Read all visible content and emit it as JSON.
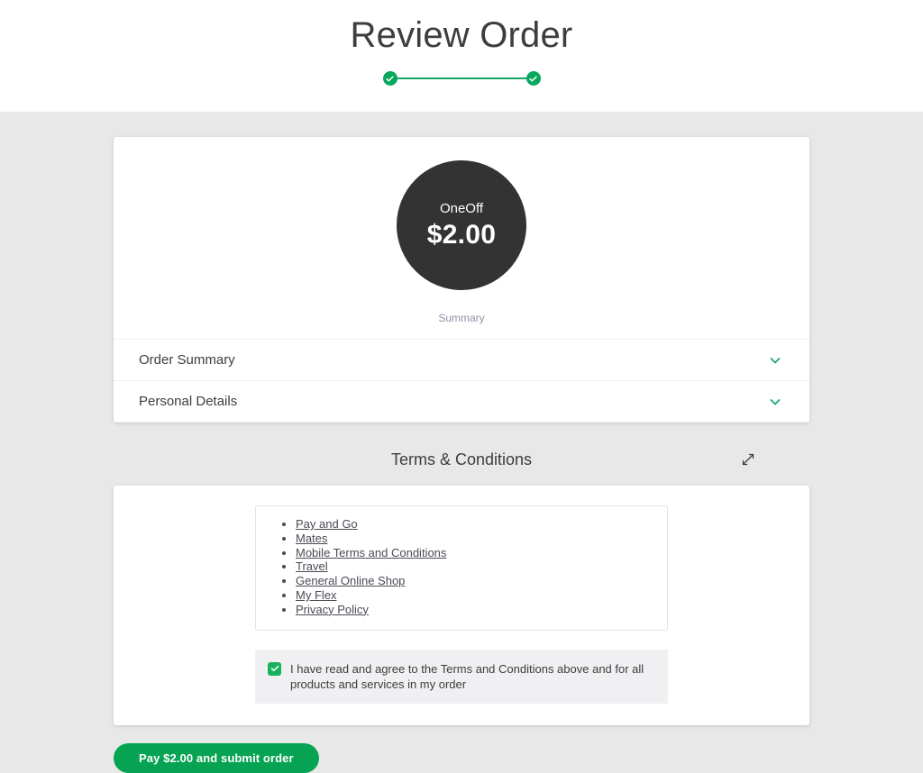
{
  "header": {
    "title": "Review Order",
    "stepper": {
      "steps": [
        {
          "name": "step-1",
          "state": "complete",
          "icon": "check-icon"
        },
        {
          "name": "step-2",
          "state": "complete",
          "icon": "check-icon"
        }
      ],
      "line_color": "#18a566",
      "dot_color": "#07a85e"
    }
  },
  "summary": {
    "bubble": {
      "label": "OneOff",
      "amount": "$2.00",
      "background": "#333333"
    },
    "caption": "Summary",
    "accordions": [
      {
        "label": "Order Summary",
        "icon": "chevron-down-icon",
        "expanded": false
      },
      {
        "label": "Personal Details",
        "icon": "chevron-down-icon",
        "expanded": false
      }
    ],
    "chevron_color": "#1aa877"
  },
  "terms": {
    "heading": "Terms & Conditions",
    "expand_icon": "expand-diagonal-icon",
    "links": [
      "Pay and Go",
      "Mates",
      "Mobile Terms and Conditions",
      "Travel",
      "General Online Shop",
      "My Flex",
      "Privacy Policy"
    ],
    "agreement": {
      "checked": true,
      "icon": "check-icon",
      "text": "I have read and agree to the Terms and Conditions above and for all products and services in my order",
      "checkbox_color": "#18b15f"
    }
  },
  "submit": {
    "label": "Pay $2.00 and submit order",
    "color": "#05a352"
  },
  "theme": {
    "page_background": "#e8e8e8",
    "card_background": "#ffffff",
    "text_color": "#3d3d3d",
    "muted_text": "#8d92a8",
    "accent_green": "#05a352"
  }
}
